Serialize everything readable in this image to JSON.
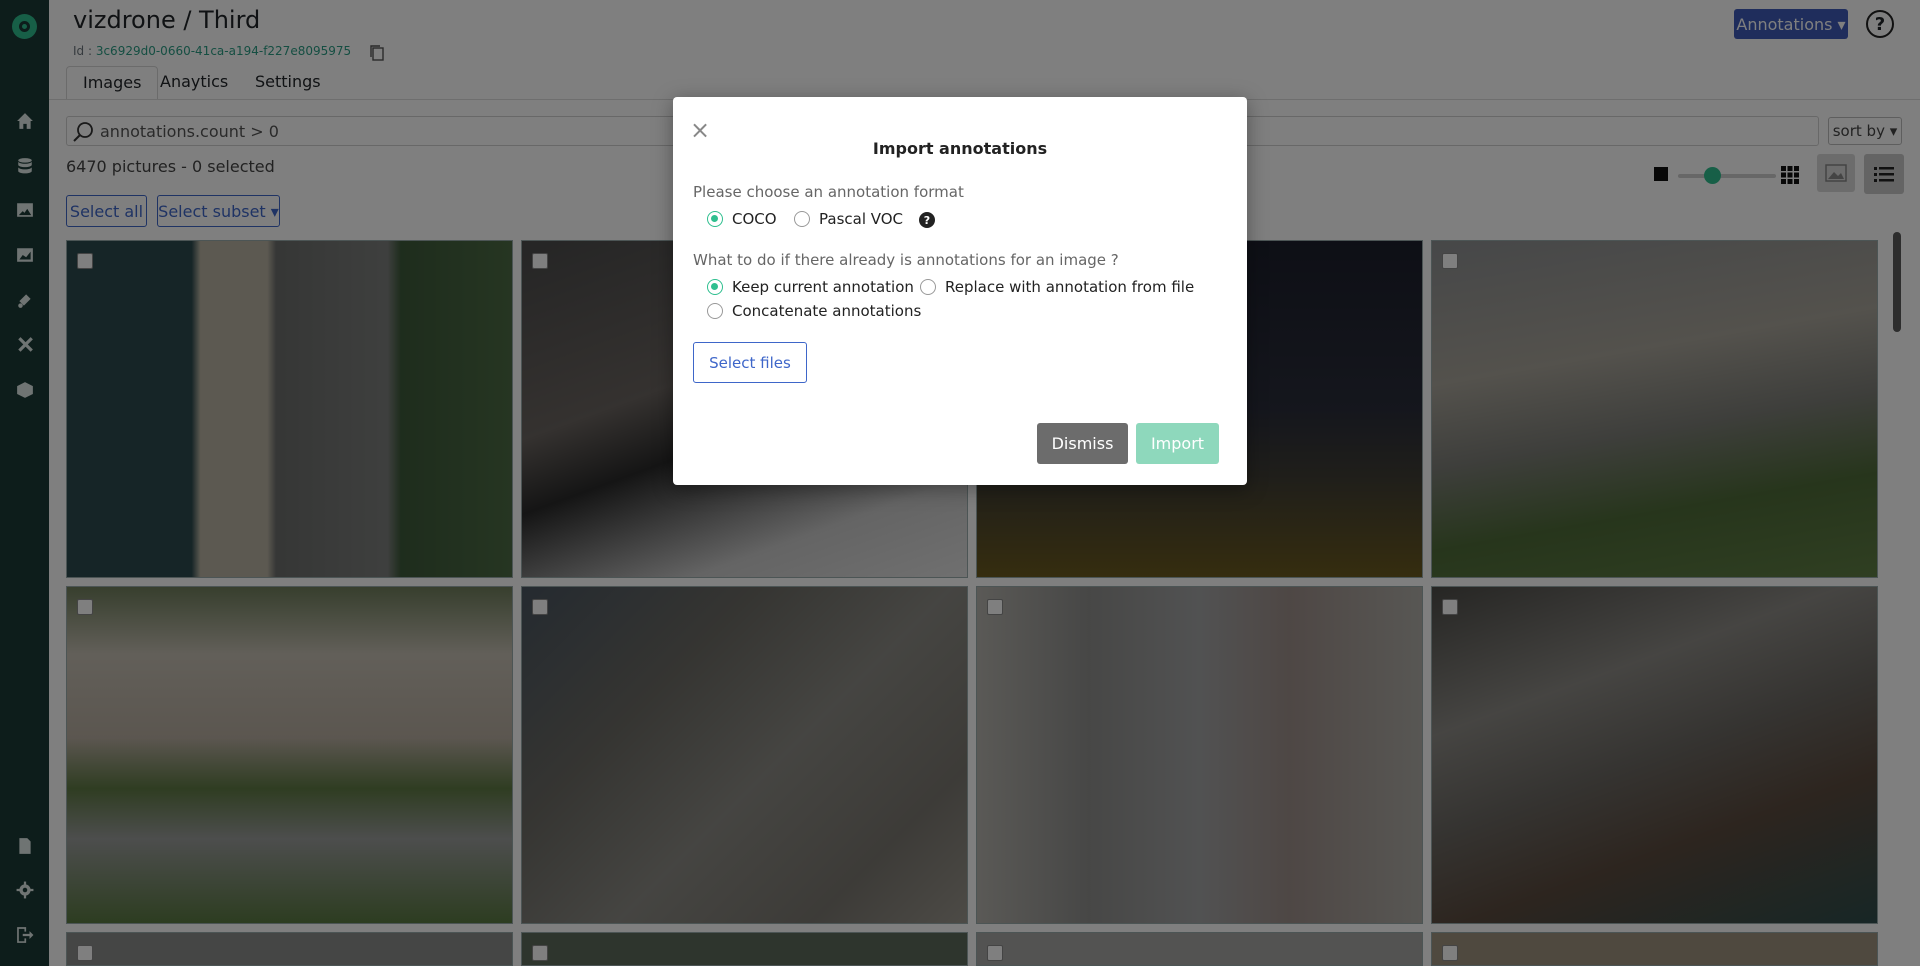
{
  "header": {
    "title": "vizdrone / Third",
    "id_label": "Id : ",
    "id_value": "3c6929d0-0660-41ca-a194-f227e8095975",
    "annotations_button": "Annotations ▾",
    "help": "?"
  },
  "tabs": [
    {
      "label": "Images"
    },
    {
      "label": "Anaytics"
    },
    {
      "label": "Settings"
    }
  ],
  "search": {
    "value": "annotations.count > 0"
  },
  "sort_label": "sort by ▾",
  "count_text": "6470 pictures - 0 selected",
  "select_all": "Select all",
  "select_subset": "Select subset ▾",
  "dialog": {
    "close": "×",
    "title": "Import annotations",
    "format_label": "Please choose an annotation format",
    "formats": [
      "COCO",
      "Pascal VOC"
    ],
    "existing_label": "What to do if there already is annotations for an image ?",
    "options": [
      "Keep current annotation",
      "Replace with annotation from file",
      "Concatenate annotations"
    ],
    "select_files": "Select files",
    "dismiss": "Dismiss",
    "import": "Import",
    "help": "?"
  },
  "colors": {
    "sidebar": "#1b3a36",
    "accent": "#2fbf8f",
    "primary": "#3e5ab8"
  }
}
